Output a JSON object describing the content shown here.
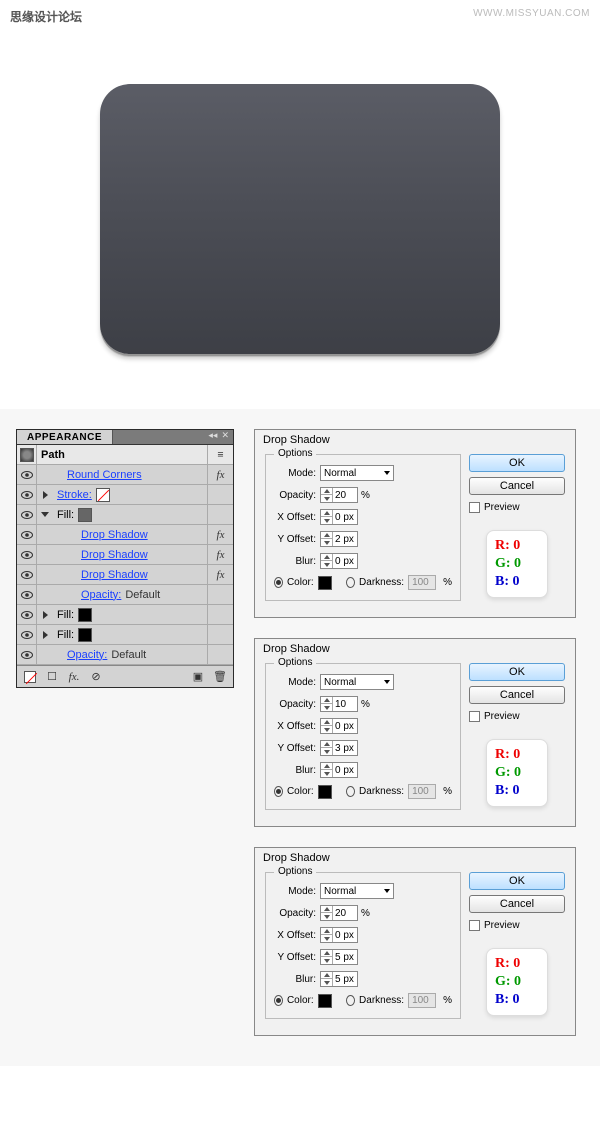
{
  "watermark": {
    "cn": "思缘设计论坛",
    "en": "WWW.MISSYUAN.COM"
  },
  "appearance": {
    "title": "APPEARANCE",
    "path_label": "Path",
    "rows": [
      {
        "label": "Round Corners",
        "link": true,
        "fx": true,
        "indent": 1
      },
      {
        "label": "Stroke:",
        "link": true,
        "swatch": "none",
        "indent": 0,
        "tri": "right"
      },
      {
        "label": "Fill:",
        "link": false,
        "swatch": "gray",
        "indent": 0,
        "tri": "down"
      },
      {
        "label": "Drop Shadow",
        "link": true,
        "fx": true,
        "indent": 2
      },
      {
        "label": "Drop Shadow",
        "link": true,
        "fx": true,
        "indent": 2
      },
      {
        "label": "Drop Shadow",
        "link": true,
        "fx": true,
        "indent": 2
      },
      {
        "label": "Opacity:",
        "value": "Default",
        "link": true,
        "indent": 2
      },
      {
        "label": "Fill:",
        "swatch": "black",
        "indent": 0,
        "tri": "right"
      },
      {
        "label": "Fill:",
        "swatch": "black",
        "indent": 0,
        "tri": "right"
      },
      {
        "label": "Opacity:",
        "value": "Default",
        "link": true,
        "indent": 1
      }
    ]
  },
  "dialogs": [
    {
      "title": "Drop Shadow",
      "options_legend": "Options",
      "mode_label": "Mode:",
      "mode_value": "Normal",
      "opacity_label": "Opacity:",
      "opacity_value": "20",
      "opacity_unit": "%",
      "xoff_label": "X Offset:",
      "xoff_value": "0 px",
      "yoff_label": "Y Offset:",
      "yoff_value": "2 px",
      "blur_label": "Blur:",
      "blur_value": "0 px",
      "color_label": "Color:",
      "darkness_label": "Darkness:",
      "darkness_value": "100",
      "darkness_unit": "%",
      "ok": "OK",
      "cancel": "Cancel",
      "preview": "Preview",
      "rgb": {
        "r": "R:  0",
        "g": "G:  0",
        "b": "B:  0"
      }
    },
    {
      "title": "Drop Shadow",
      "options_legend": "Options",
      "mode_label": "Mode:",
      "mode_value": "Normal",
      "opacity_label": "Opacity:",
      "opacity_value": "10",
      "opacity_unit": "%",
      "xoff_label": "X Offset:",
      "xoff_value": "0 px",
      "yoff_label": "Y Offset:",
      "yoff_value": "3 px",
      "blur_label": "Blur:",
      "blur_value": "0 px",
      "color_label": "Color:",
      "darkness_label": "Darkness:",
      "darkness_value": "100",
      "darkness_unit": "%",
      "ok": "OK",
      "cancel": "Cancel",
      "preview": "Preview",
      "rgb": {
        "r": "R:  0",
        "g": "G:  0",
        "b": "B:  0"
      }
    },
    {
      "title": "Drop Shadow",
      "options_legend": "Options",
      "mode_label": "Mode:",
      "mode_value": "Normal",
      "opacity_label": "Opacity:",
      "opacity_value": "20",
      "opacity_unit": "%",
      "xoff_label": "X Offset:",
      "xoff_value": "0 px",
      "yoff_label": "Y Offset:",
      "yoff_value": "5 px",
      "blur_label": "Blur:",
      "blur_value": "5 px",
      "color_label": "Color:",
      "darkness_label": "Darkness:",
      "darkness_value": "100",
      "darkness_unit": "%",
      "ok": "OK",
      "cancel": "Cancel",
      "preview": "Preview",
      "rgb": {
        "r": "R:  0",
        "g": "G:  0",
        "b": "B:  0"
      }
    }
  ]
}
